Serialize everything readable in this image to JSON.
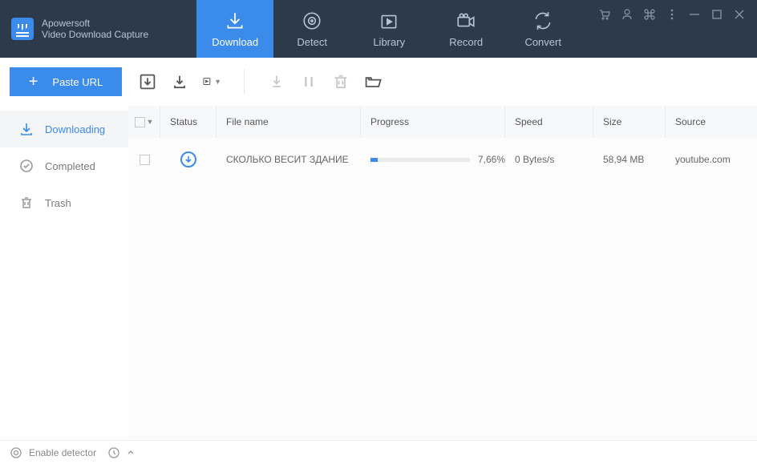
{
  "app": {
    "vendor": "Apowersoft",
    "name": "Video Download Capture"
  },
  "tabs": [
    {
      "label": "Download",
      "active": true
    },
    {
      "label": "Detect"
    },
    {
      "label": "Library"
    },
    {
      "label": "Record"
    },
    {
      "label": "Convert"
    }
  ],
  "toolbar": {
    "paste_label": "Paste URL"
  },
  "sidebar": {
    "items": [
      {
        "label": "Downloading",
        "active": true
      },
      {
        "label": "Completed"
      },
      {
        "label": "Trash"
      }
    ]
  },
  "columns": {
    "status": "Status",
    "filename": "File name",
    "progress": "Progress",
    "speed": "Speed",
    "size": "Size",
    "source": "Source"
  },
  "rows": [
    {
      "filename": "СКОЛЬКО ВЕСИТ ЗДАНИЕ",
      "progress_pct": 7.66,
      "progress_text": "7,66%",
      "speed": "0 Bytes/s",
      "size": "58,94 MB",
      "source": "youtube.com"
    }
  ],
  "footer": {
    "detector": "Enable detector"
  }
}
